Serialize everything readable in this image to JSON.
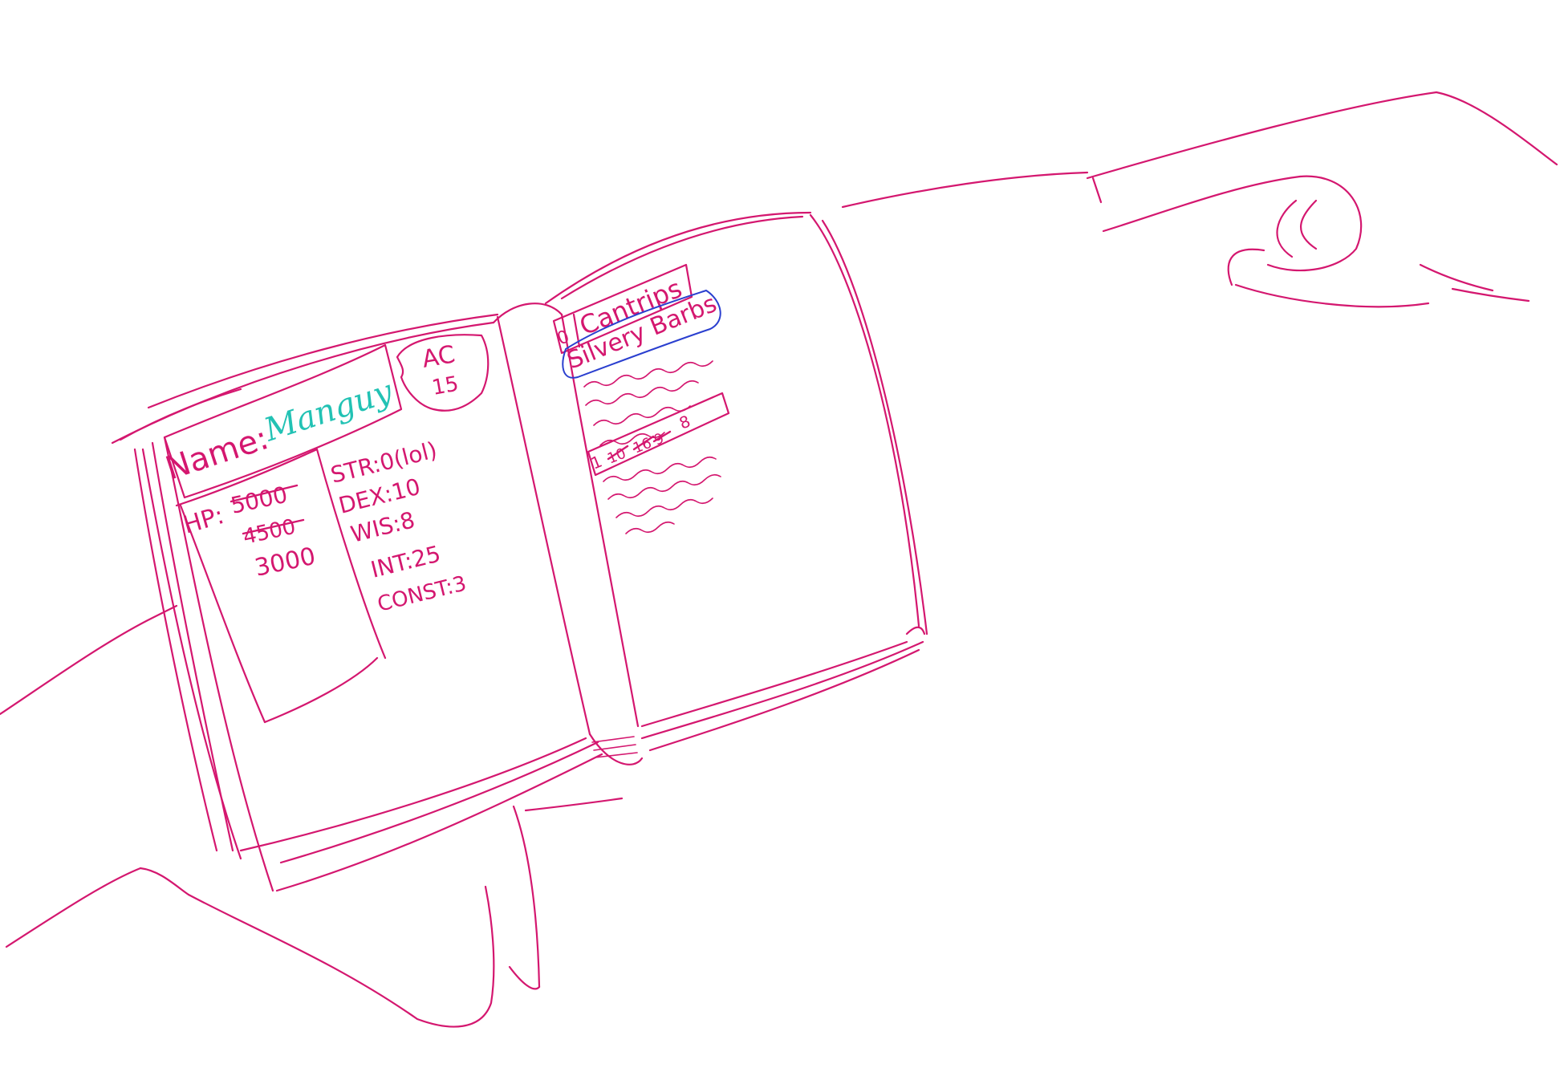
{
  "palette": {
    "ink": "#d4176f",
    "name_ink": "#22c2b4",
    "highlight_ink": "#2a3fcf",
    "background": "#ffffff"
  },
  "character_sheet": {
    "name_label": "Name:",
    "name_value": "Manguy",
    "armor_class": {
      "label": "AC",
      "value": "15"
    },
    "hp": {
      "label": "HP:",
      "history": [
        "5000",
        "4500"
      ],
      "current": "3000"
    },
    "stats": [
      "STR:0(lol)",
      "DEX:10",
      "WIS:8",
      "INT:25",
      "CONST:3"
    ]
  },
  "spell_page": {
    "cantrips": {
      "level": "0",
      "label": "Cantrips"
    },
    "highlighted_spell": "Silvery Barbs",
    "level_1": {
      "level": "1",
      "slots_crossed": [
        "10",
        "16",
        "9"
      ],
      "slots_current": "8"
    }
  }
}
